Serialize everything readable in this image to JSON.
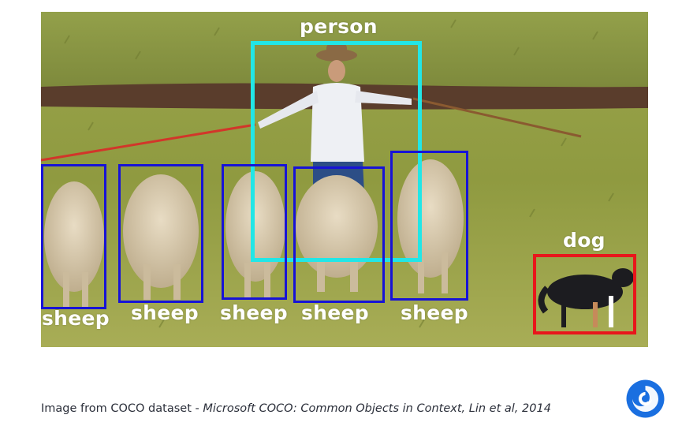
{
  "image": {
    "detections": [
      {
        "label": "person",
        "color": "#22e6e6"
      },
      {
        "label": "dog",
        "color": "#e8161b"
      },
      {
        "label": "sheep",
        "color": "#1713d6"
      },
      {
        "label": "sheep",
        "color": "#1713d6"
      },
      {
        "label": "sheep",
        "color": "#1713d6"
      },
      {
        "label": "sheep",
        "color": "#1713d6"
      },
      {
        "label": "sheep",
        "color": "#1713d6"
      }
    ]
  },
  "caption": {
    "prefix": "Image from COCO dataset - ",
    "citation": "Microsoft COCO: Common Objects in Context, Lin et al, 2014"
  },
  "logo": {
    "icon": "swirl-logo-icon",
    "color": "#1a6fe0"
  }
}
